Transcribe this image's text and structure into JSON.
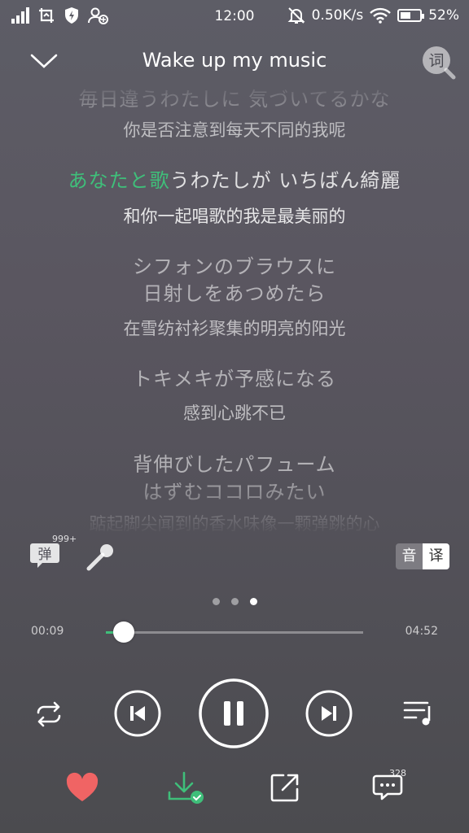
{
  "status_bar": {
    "time": "12:00",
    "net_speed": "0.50K/s",
    "battery_pct": "52%",
    "battery_level": 0.52
  },
  "header": {
    "title": "Wake up my music",
    "lyric_button_label": "词"
  },
  "lyrics": [
    {
      "jp": "毎日違うわたしに 気づいてるかな",
      "cn": "你是否注意到每天不同的我呢",
      "active": false
    },
    {
      "jp_highlight": "あなたと歌",
      "jp_rest": "うわたしが いちばん綺麗",
      "cn": "和你一起唱歌的我是最美丽的",
      "active": true
    },
    {
      "jp": "シフォンのブラウスに",
      "jp2": "日射しをあつめたら",
      "cn": "在雪纺衬衫聚集的明亮的阳光",
      "active": false
    },
    {
      "jp": "トキメキが予感になる",
      "cn": "感到心跳不已",
      "active": false
    },
    {
      "jp": "背伸びしたパフューム",
      "jp2": "はずむココロみたい",
      "cn": "踮起脚尖闻到的香水味像一颗弹跳的心",
      "active": false
    }
  ],
  "tools": {
    "danmu_label": "弹",
    "danmu_count": "999+",
    "toggle_yin": "音",
    "toggle_yi": "译"
  },
  "page_indicator": {
    "count": 3,
    "active": 2
  },
  "progress": {
    "current": "00:09",
    "total": "04:52",
    "fraction": 0.07
  },
  "bottom": {
    "comment_count": "328"
  },
  "colors": {
    "accent": "#3fbf7a",
    "heart": "#f06464"
  }
}
